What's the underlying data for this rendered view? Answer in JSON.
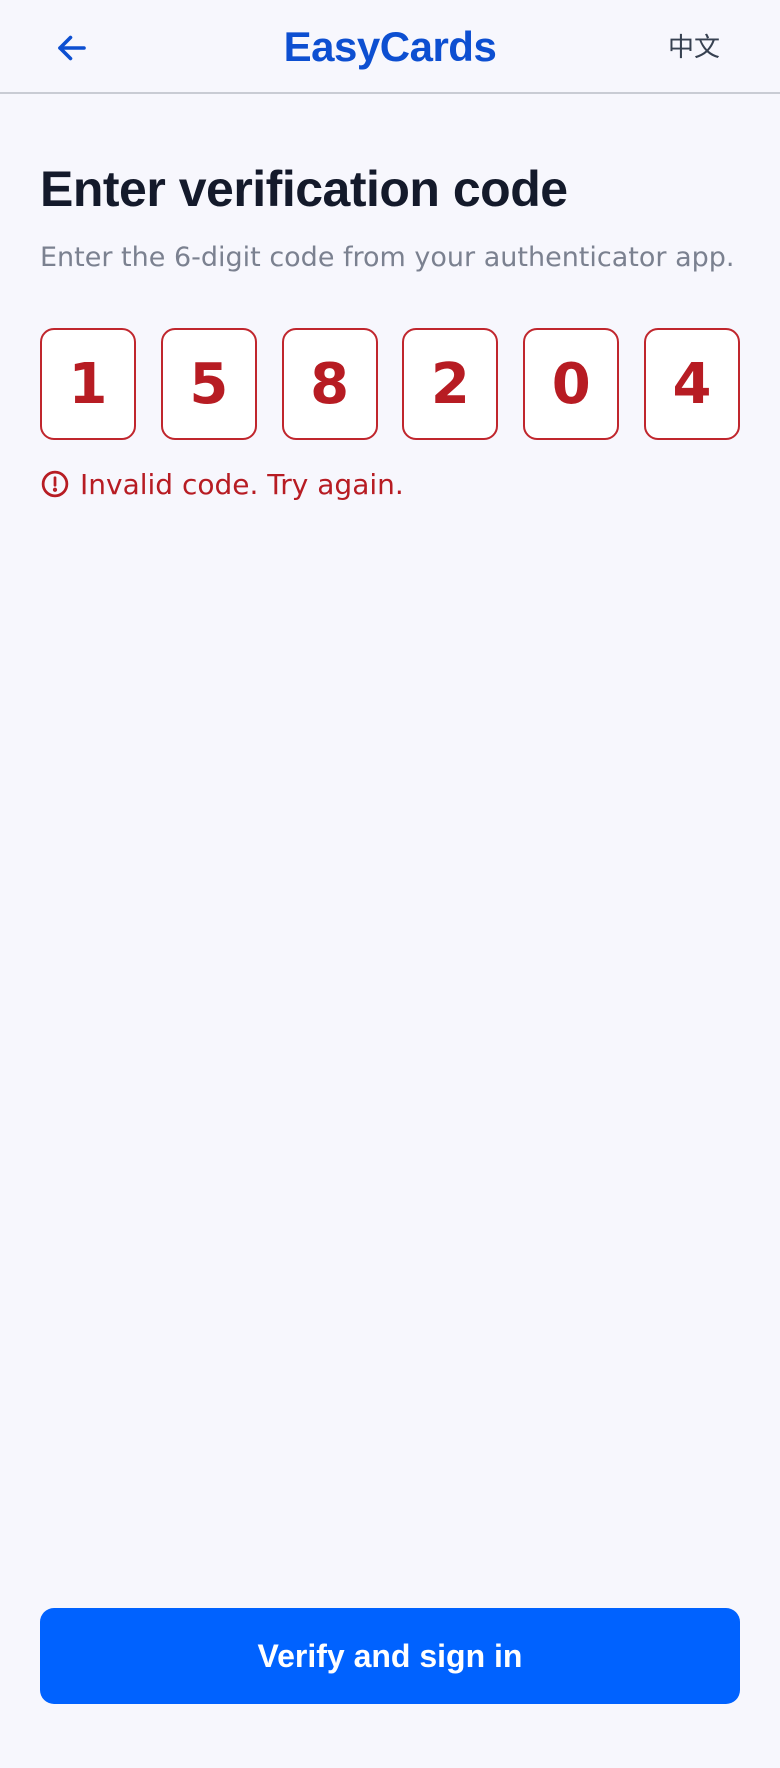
{
  "header": {
    "title": "EasyCards",
    "language_label": "中文",
    "back_icon": "arrow-left-icon"
  },
  "main": {
    "title": "Enter verification code",
    "subtitle": "Enter the 6-digit code from your authenticator app.",
    "code_digits": [
      "1",
      "5",
      "8",
      "2",
      "0",
      "4"
    ],
    "error_icon": "alert-circle-icon",
    "error_message": "Invalid code. Try again."
  },
  "actions": {
    "primary_label": "Verify and sign in"
  },
  "colors": {
    "brand": "#0d4fd1",
    "primary_button": "#0062ff",
    "error": "#b71c23",
    "background": "#f7f7fd"
  }
}
